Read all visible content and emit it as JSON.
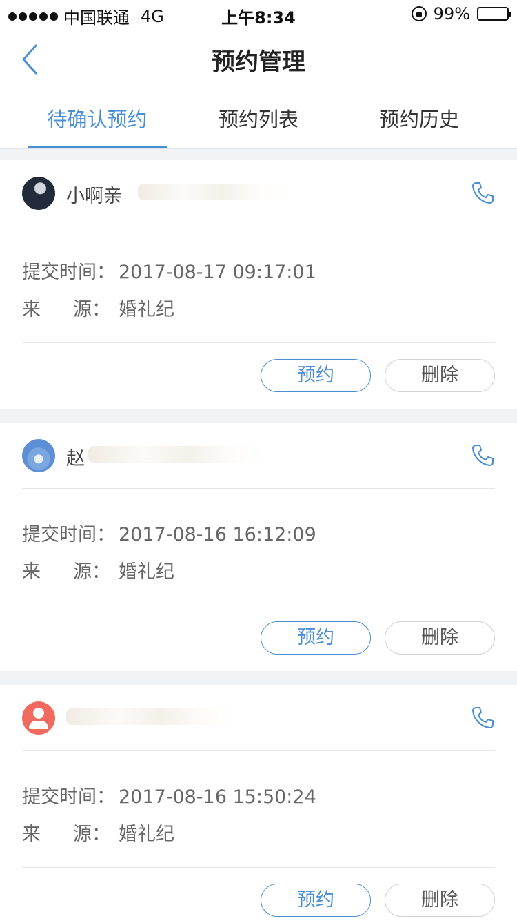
{
  "status": {
    "carrier": "中国联通",
    "network": "4G",
    "time": "上午8:34",
    "battery": "99%"
  },
  "nav": {
    "title": "预约管理"
  },
  "tabs": [
    {
      "label": "待确认预约",
      "active": true
    },
    {
      "label": "预约列表",
      "active": false
    },
    {
      "label": "预约历史",
      "active": false
    }
  ],
  "labels": {
    "submit_time": "提交时间：",
    "source_a": "来",
    "source_b": "源：",
    "book_button": "预约",
    "delete_button": "删除"
  },
  "appointments": [
    {
      "name": "小啊亲",
      "submit_time": "2017-08-17 09:17:01",
      "source": "婚礼纪",
      "avatar": "photo"
    },
    {
      "name": "赵",
      "submit_time": "2017-08-16 16:12:09",
      "source": "婚礼纪",
      "avatar": "photo"
    },
    {
      "name": "",
      "submit_time": "2017-08-16 15:50:24",
      "source": "婚礼纪",
      "avatar": "default"
    }
  ],
  "colors": {
    "accent": "#4a8fd6",
    "background": "#f2f3f7",
    "default_avatar": "#f06a5f"
  },
  "icons": [
    "back-icon",
    "phone-icon",
    "lock-icon",
    "battery-icon"
  ]
}
